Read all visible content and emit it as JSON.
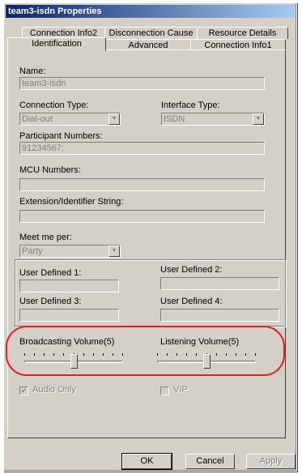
{
  "window": {
    "title": "team3-isdn Properties"
  },
  "tabs_row1": [
    "Connection Info2",
    "Disconnection Cause",
    "Resource Details"
  ],
  "tabs_row2": [
    "Identification",
    "Advanced",
    "Connection Info1"
  ],
  "active_tab": "Identification",
  "form": {
    "name_label": "Name:",
    "name_value": "team3-isdn",
    "connection_type_label": "Connection Type:",
    "connection_type_value": "Dial-out",
    "interface_type_label": "Interface Type:",
    "interface_type_value": "ISDN",
    "participant_numbers_label": "Participant Numbers:",
    "participant_numbers_value": "91234567;",
    "mcu_numbers_label": "MCU Numbers:",
    "mcu_numbers_value": "",
    "extension_label": "Extension/Identifier String:",
    "extension_value": "",
    "meet_me_label": "Meet me per:",
    "meet_me_value": "Party",
    "user_defined_1_label": "User Defined 1:",
    "user_defined_2_label": "User Defined 2:",
    "user_defined_3_label": "User Defined 3:",
    "user_defined_4_label": "User Defined 4:",
    "broadcasting_volume_label": "Broadcasting Volume(5)",
    "broadcasting_volume_level": 5,
    "listening_volume_label": "Listening Volume(5)",
    "listening_volume_level": 5,
    "audio_only_label": "Audio Only",
    "audio_only_checked": true,
    "vip_label": "VIP",
    "vip_checked": false
  },
  "buttons": {
    "ok": "OK",
    "cancel": "Cancel",
    "apply": "Apply"
  },
  "colors": {
    "title_bar": "#0a246a",
    "dialog_bg": "#d4d0c8",
    "highlight_annotation": "#e0201c"
  }
}
